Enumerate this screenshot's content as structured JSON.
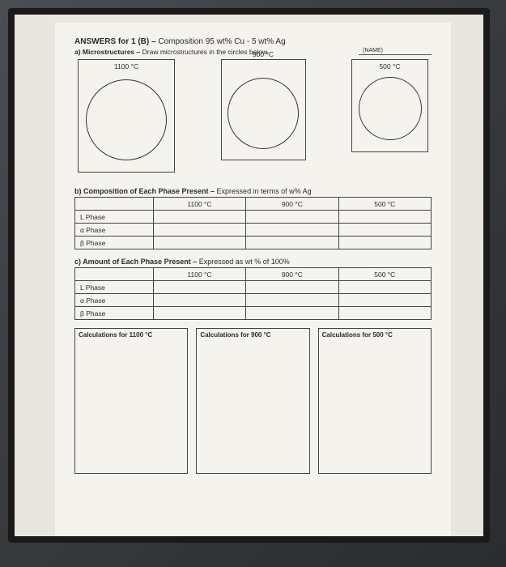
{
  "header": {
    "title_prefix": "ANSWERS for 1 (B) – ",
    "title_rest": "Composition 95 wt% Cu - 5 wt% Ag",
    "part_a_prefix": "a) Microstructures – ",
    "part_a_rest": "Draw microstructures in the circles below.",
    "name_label": "(NAME)"
  },
  "circles": [
    {
      "label": "1100 °C"
    },
    {
      "label": "900 °C"
    },
    {
      "label": "500 °C"
    }
  ],
  "section_b": {
    "prefix": "b) Composition of Each Phase Present – ",
    "rest": "Expressed in terms of w% Ag",
    "cols": [
      "1100 °C",
      "900 °C",
      "500 °C"
    ],
    "rows": [
      "L Phase",
      "α Phase",
      "β Phase"
    ]
  },
  "section_c": {
    "prefix": "c) Amount of Each Phase Present – ",
    "rest": "Expressed as wt % of 100%",
    "cols": [
      "1100 °C",
      "900 °C",
      "500 °C"
    ],
    "rows": [
      "L Phase",
      "α Phase",
      "β Phase"
    ]
  },
  "calc_boxes": [
    "Calculations for 1100 °C",
    "Calculations for 900 °C",
    "Calculations for 500 °C"
  ]
}
